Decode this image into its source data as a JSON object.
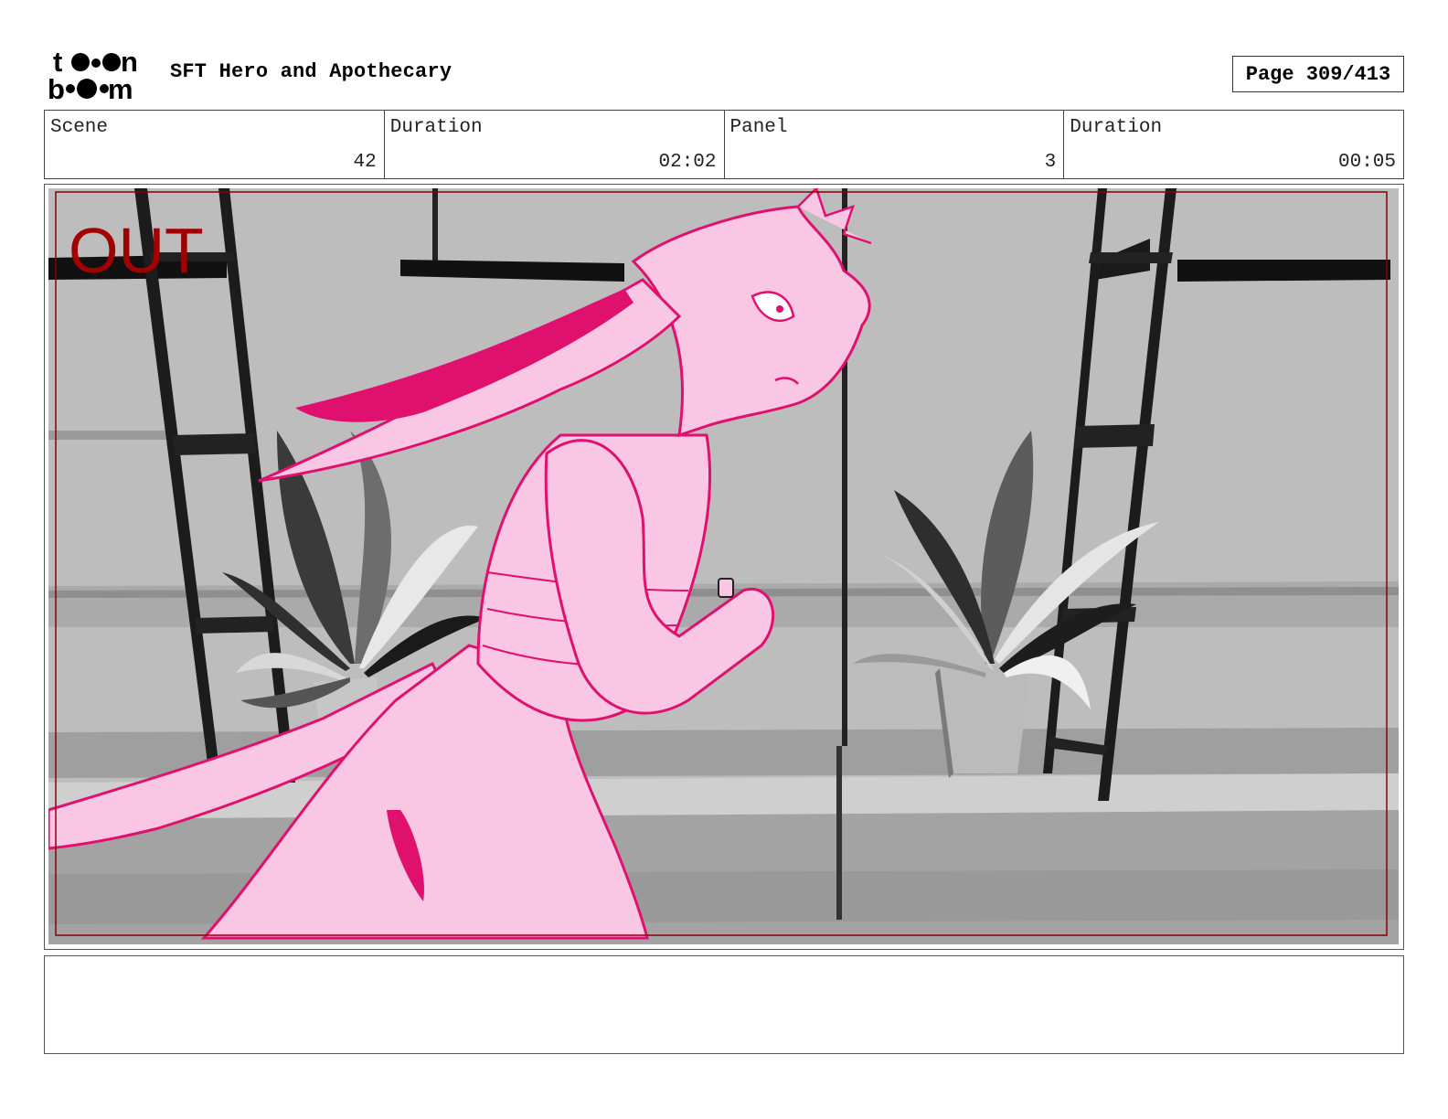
{
  "header": {
    "logo_text": "toon boom",
    "title": "SFT Hero and Apothecary",
    "page_label": "Page 309/413"
  },
  "info": {
    "scene_label": "Scene",
    "scene_value": "42",
    "scene_duration_label": "Duration",
    "scene_duration_value": "02:02",
    "panel_label": "Panel",
    "panel_value": "3",
    "panel_duration_label": "Duration",
    "panel_duration_value": "00:05"
  },
  "panel": {
    "overlay_text": "OUT",
    "overlay_color": "#a00000",
    "character_fill": "#f9c6e4",
    "character_line": "#e0106e",
    "background_tone": "#bdbdbd"
  },
  "notes": {
    "text": ""
  }
}
